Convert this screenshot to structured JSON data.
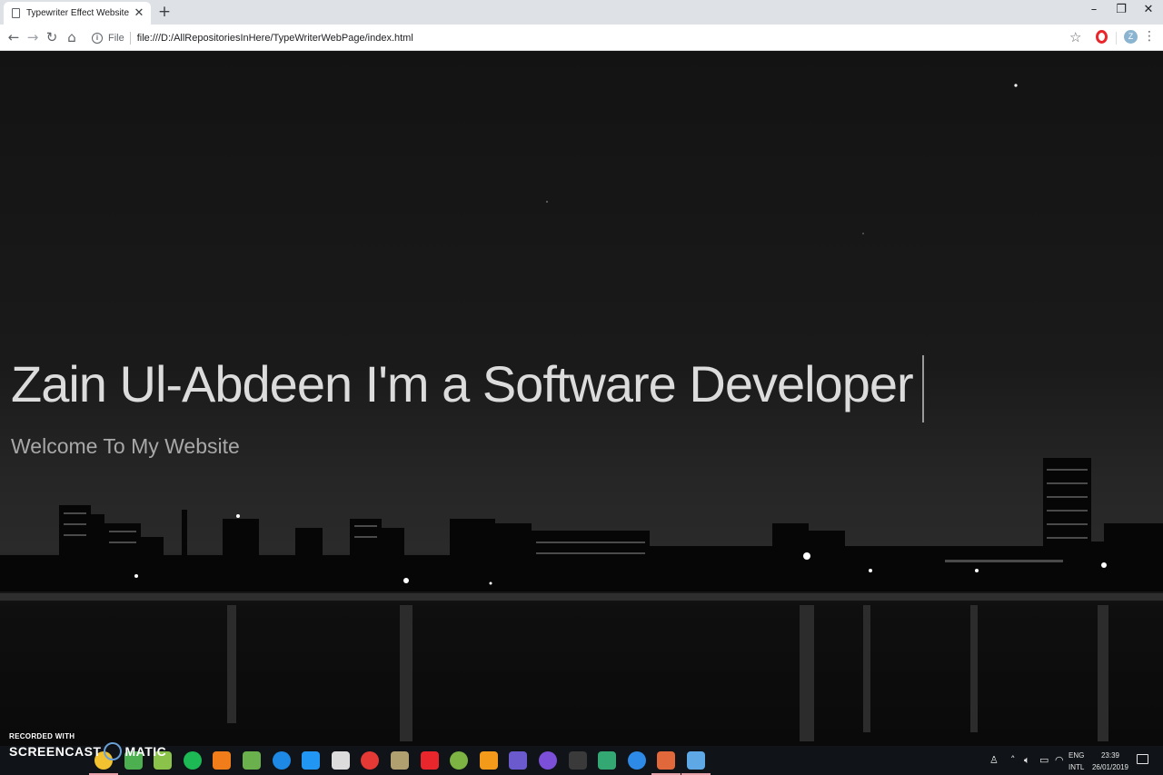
{
  "browser": {
    "tab_title": "Typewriter Effect Website",
    "tab_close": "✕",
    "new_tab": "+",
    "window": {
      "minimize": "–",
      "restore": "❐",
      "close": "✕"
    },
    "nav": {
      "back": "←",
      "forward": "→",
      "reload": "↻",
      "home": "⌂"
    },
    "address": {
      "info": "i",
      "scheme_label": "File",
      "url": "file:///D:/AllRepositoriesInHere/TypeWriterWebPage/index.html"
    },
    "bookmark": "☆",
    "profile_initial": "Z",
    "menu": "⋮"
  },
  "page": {
    "title": "Zain Ul-Abdeen I'm a Software Developer",
    "subtitle": "Welcome To My Website"
  },
  "watermark": {
    "top": "RECORDED WITH",
    "left": "SCREENCAST",
    "right": "MATIC"
  },
  "taskbar": {
    "tray": {
      "lang_top": "ENG",
      "lang_bottom": "INTL",
      "time": "23:39",
      "date": "26/01/2019"
    },
    "apps": [
      {
        "name": "chrome-icon",
        "color": "#f2c230"
      },
      {
        "name": "files-icon",
        "color": "#4caf50"
      },
      {
        "name": "notepad-icon",
        "color": "#8bc34a"
      },
      {
        "name": "spotify-icon",
        "color": "#1db954"
      },
      {
        "name": "blender-icon",
        "color": "#f07d1a"
      },
      {
        "name": "utorrent-icon",
        "color": "#6ab04c"
      },
      {
        "name": "media-player-icon",
        "color": "#1e88e5"
      },
      {
        "name": "maps-icon",
        "color": "#2196f3"
      },
      {
        "name": "unity-icon",
        "color": "#dcdcdc"
      },
      {
        "name": "acrobat-icon",
        "color": "#e53935"
      },
      {
        "name": "app-icon",
        "color": "#b0a070"
      },
      {
        "name": "opera-icon",
        "color": "#e8262c"
      },
      {
        "name": "android-studio-icon",
        "color": "#7cb342"
      },
      {
        "name": "sublime-icon",
        "color": "#f49a1a"
      },
      {
        "name": "obs-icon",
        "color": "#6a5acd"
      },
      {
        "name": "intellij-icon",
        "color": "#7b4fd8"
      },
      {
        "name": "terminal-icon",
        "color": "#3a3a3a"
      },
      {
        "name": "gitkraken-icon",
        "color": "#34a873"
      },
      {
        "name": "vscode-icon",
        "color": "#2d8ae6"
      },
      {
        "name": "brackets-icon",
        "color": "#e0683a"
      },
      {
        "name": "recorder-icon",
        "color": "#5fa8e6"
      }
    ]
  }
}
